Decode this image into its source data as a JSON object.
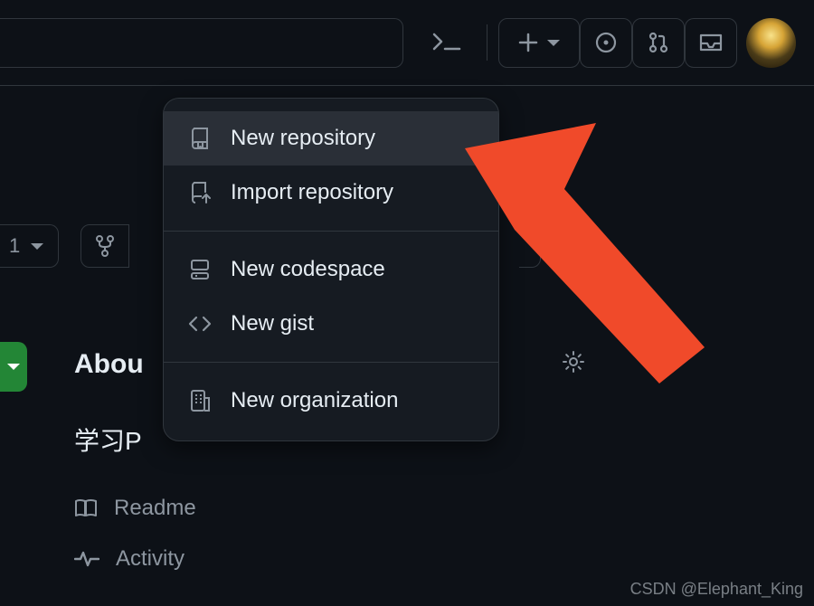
{
  "topbar": {
    "badge_count": "1"
  },
  "dropdown": {
    "items": [
      {
        "label": "New repository",
        "icon": "repo-icon"
      },
      {
        "label": "Import repository",
        "icon": "repo-push-icon"
      },
      {
        "label": "New codespace",
        "icon": "codespace-icon"
      },
      {
        "label": "New gist",
        "icon": "code-icon"
      },
      {
        "label": "New organization",
        "icon": "org-icon"
      }
    ]
  },
  "about": {
    "heading": "About",
    "heading_visible": "Abou",
    "description": "学习P",
    "links": [
      {
        "label": "Readme"
      },
      {
        "label": "Activity"
      }
    ]
  },
  "watermark": "CSDN @Elephant_King",
  "colors": {
    "bg": "#0d1117",
    "panel": "#161b22",
    "border": "#30363d",
    "text": "#e6edf3",
    "muted": "#8d96a0",
    "accent_green": "#238636",
    "arrow": "#f04a2a"
  }
}
